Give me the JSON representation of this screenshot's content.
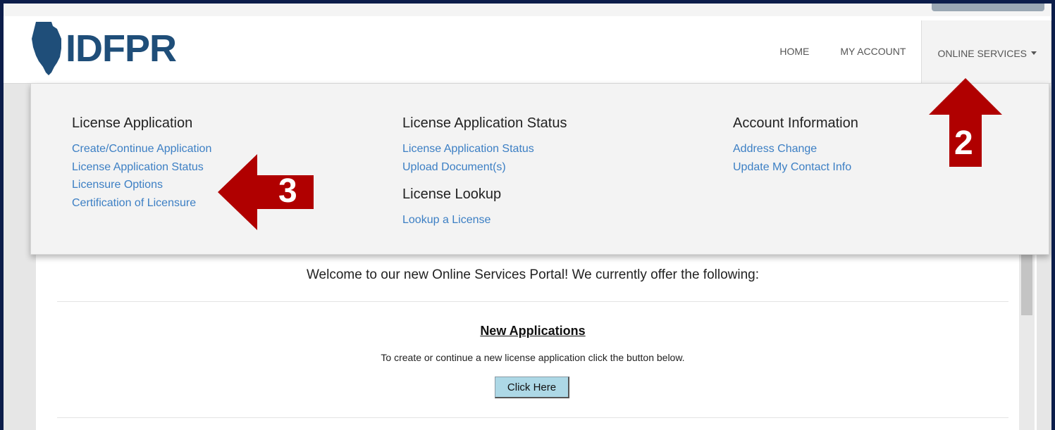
{
  "brand": {
    "logo_text": "IDFPR"
  },
  "nav": {
    "items": [
      {
        "label": "HOME"
      },
      {
        "label": "MY ACCOUNT"
      },
      {
        "label": "ONLINE SERVICES"
      }
    ]
  },
  "dropdown": {
    "col1": {
      "heading": "License Application",
      "links": [
        "Create/Continue Application",
        "License Application Status",
        "Licensure Options",
        "Certification of Licensure"
      ]
    },
    "col2": {
      "heading": "License Application Status",
      "links": [
        "License Application Status",
        "Upload Document(s)"
      ],
      "heading2": "License Lookup",
      "links2": [
        "Lookup a License"
      ]
    },
    "col3": {
      "heading": "Account Information",
      "links": [
        "Address Change",
        "Update My Contact Info"
      ]
    }
  },
  "main": {
    "welcome": "Welcome to our new Online Services Portal! We currently offer the following:",
    "section_title": "New Applications",
    "section_desc": "To create or continue a new license application click the button below.",
    "button_label": "Click Here"
  },
  "annotations": {
    "arrow_2": "2",
    "arrow_3": "3"
  },
  "colors": {
    "arrow": "#b00000",
    "link": "#3c7fc4",
    "brand": "#1f4e79",
    "button": "#add8e6"
  },
  "icons": {
    "nav_caret": "caret-down-icon",
    "logo_shape": "illinois-state-icon"
  }
}
